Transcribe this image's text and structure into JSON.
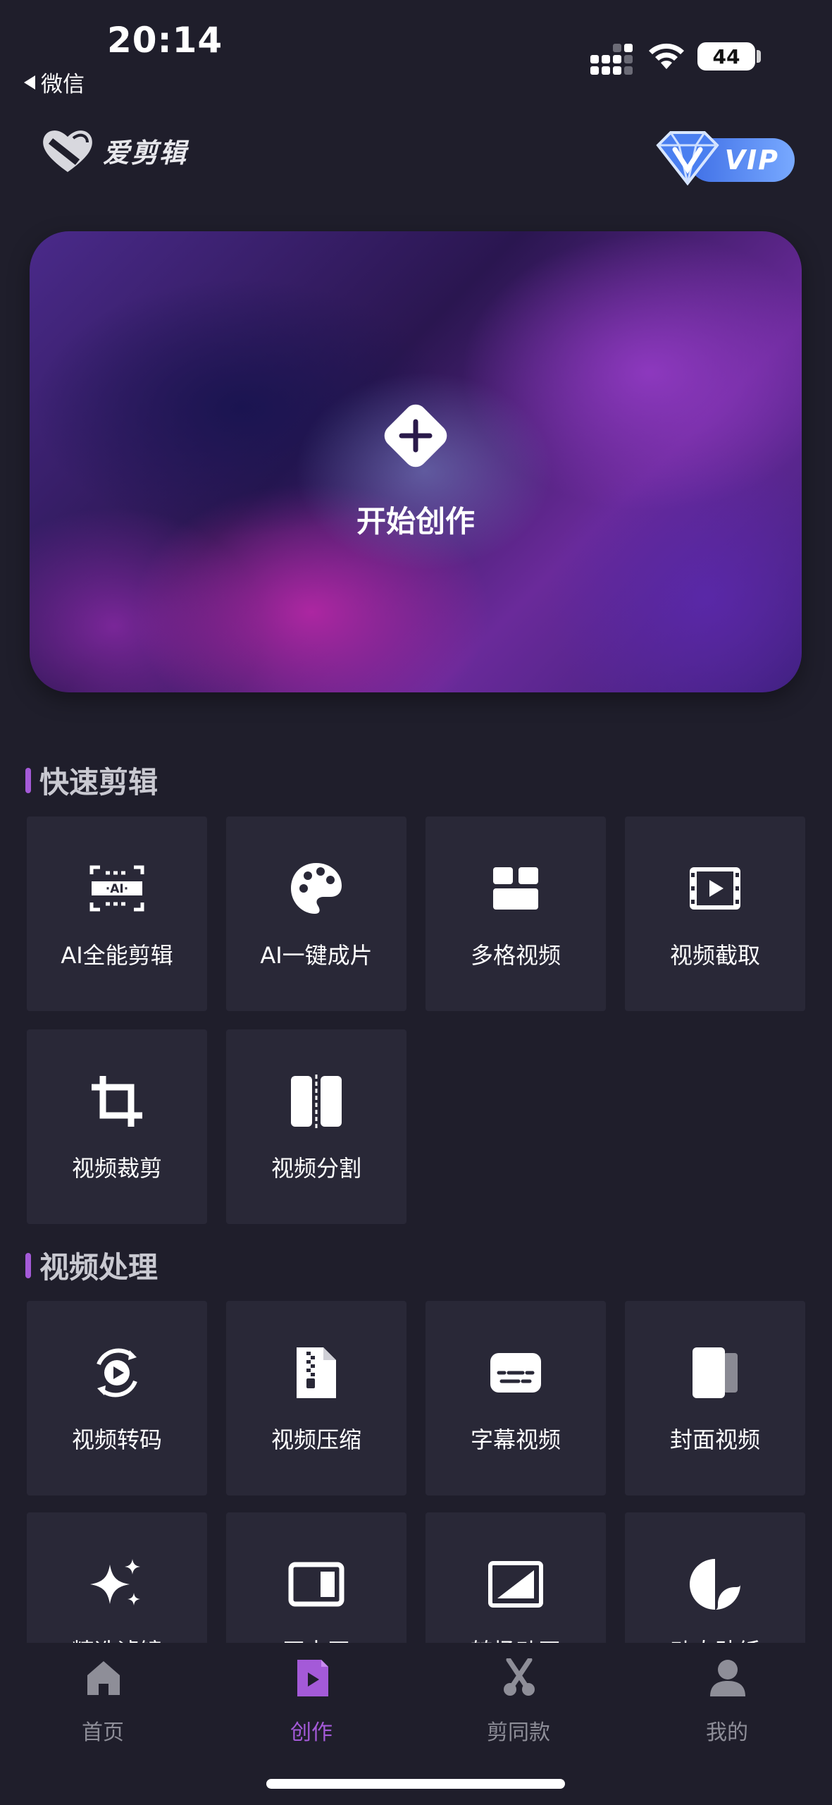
{
  "status": {
    "time": "20:14",
    "back_app": "微信",
    "battery": "44"
  },
  "header": {
    "logo_text": "爱剪辑",
    "vip_label": "VIP"
  },
  "hero": {
    "label": "开始创作"
  },
  "sections": {
    "quick_edit": {
      "title": "快速剪辑",
      "items": [
        {
          "label": "AI全能剪辑",
          "icon": "ai-frame-icon"
        },
        {
          "label": "AI一键成片",
          "icon": "palette-icon"
        },
        {
          "label": "多格视频",
          "icon": "grid-icon"
        },
        {
          "label": "视频截取",
          "icon": "film-play-icon"
        },
        {
          "label": "视频裁剪",
          "icon": "crop-icon"
        },
        {
          "label": "视频分割",
          "icon": "split-icon"
        }
      ]
    },
    "video_processing": {
      "title": "视频处理",
      "items": [
        {
          "label": "视频转码",
          "icon": "convert-play-icon"
        },
        {
          "label": "视频压缩",
          "icon": "zip-file-icon"
        },
        {
          "label": "字幕视频",
          "icon": "subtitle-icon"
        },
        {
          "label": "封面视频",
          "icon": "cover-icon"
        },
        {
          "label": "精选滤镜",
          "icon": "sparkle-icon"
        },
        {
          "label": "画中画",
          "icon": "pip-icon"
        },
        {
          "label": "转场动画",
          "icon": "transition-icon"
        },
        {
          "label": "动态贴纸",
          "icon": "sticker-icon"
        }
      ]
    }
  },
  "tabbar": {
    "items": [
      {
        "label": "首页",
        "icon": "home-icon"
      },
      {
        "label": "创作",
        "icon": "create-icon",
        "active": true
      },
      {
        "label": "剪同款",
        "icon": "scissors-icon"
      },
      {
        "label": "我的",
        "icon": "profile-icon"
      }
    ]
  },
  "colors": {
    "background": "#1f1e2b",
    "tile": "#292837",
    "accent": "#a45ad8"
  }
}
